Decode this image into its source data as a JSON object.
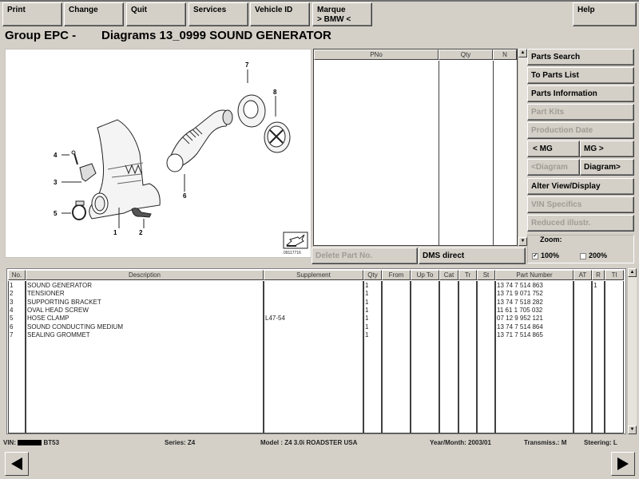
{
  "toolbar": {
    "print": "Print",
    "change": "Change",
    "quit": "Quit",
    "services": "Services",
    "vehicle_id": "Vehicle ID",
    "marque_line1": "Marque",
    "marque_line2": "> BMW <",
    "help": "Help"
  },
  "header": {
    "group": "Group EPC -",
    "diagram": "Diagrams 13_0999 SOUND GENERATOR"
  },
  "diagram": {
    "callouts": [
      "1",
      "2",
      "3",
      "4",
      "5",
      "6",
      "7",
      "8"
    ],
    "image_id": "09117716"
  },
  "pno_list": {
    "columns": [
      "PNo",
      "Qty",
      "N"
    ],
    "rows": []
  },
  "side_buttons": {
    "parts_search": "Parts Search",
    "to_parts_list": "To Parts List",
    "parts_information": "Parts Information",
    "part_kits": "Part Kits",
    "production_date": "Production Date",
    "prev_mg": "< MG",
    "next_mg": "MG >",
    "prev_diagram": "<Diagram",
    "next_diagram": "Diagram>",
    "alter_view": "Alter View/Display",
    "vin_specifics": "VIN Specifics",
    "reduced_illustr": "Reduced illustr."
  },
  "actions": {
    "delete_part_no": "Delete Part No.",
    "dms_direct": "DMS direct"
  },
  "zoom": {
    "label": "Zoom:",
    "option_100": "100%",
    "option_200": "200%",
    "checked_100": "✓",
    "checked_200": ""
  },
  "parts_table": {
    "columns": [
      "No.",
      "Description",
      "Supplement",
      "Qty",
      "From",
      "Up To",
      "Cat",
      "Tr",
      "St",
      "Part Number",
      "AT",
      "R",
      "Tl"
    ],
    "rows": [
      {
        "no": "1",
        "description": "SOUND GENERATOR",
        "supplement": "",
        "qty": "1",
        "part_number": "13 74 7 514 863",
        "r": "1"
      },
      {
        "no": "2",
        "description": "TENSIONER",
        "supplement": "",
        "qty": "1",
        "part_number": "13 71 9 071 752",
        "r": ""
      },
      {
        "no": "3",
        "description": "SUPPORTING BRACKET",
        "supplement": "",
        "qty": "1",
        "part_number": "13 74 7 518 282",
        "r": ""
      },
      {
        "no": "4",
        "description": "OVAL HEAD SCREW",
        "supplement": "",
        "qty": "1",
        "part_number": "11 61 1 705 032",
        "r": ""
      },
      {
        "no": "5",
        "description": "HOSE CLAMP",
        "supplement": "L47-54",
        "qty": "1",
        "part_number": "07 12 9 952 121",
        "r": ""
      },
      {
        "no": "6",
        "description": "SOUND CONDUCTING MEDIUM",
        "supplement": "",
        "qty": "1",
        "part_number": "13 74 7 514 864",
        "r": ""
      },
      {
        "no": "7",
        "description": "SEALING GROMMET",
        "supplement": "",
        "qty": "1",
        "part_number": "13 71 7 514 865",
        "r": ""
      }
    ]
  },
  "status_bar": {
    "vin_label": "VIN:",
    "vin_suffix": "BT53",
    "series": "Series: Z4",
    "model": "Model : Z4 3.0i ROADSTER USA",
    "year_month": "Year/Month: 2003/01",
    "transmission": "Transmiss.: M",
    "steering": "Steering: L"
  },
  "nav": {
    "back_icon": "triangle-left",
    "forward_icon": "triangle-right"
  }
}
